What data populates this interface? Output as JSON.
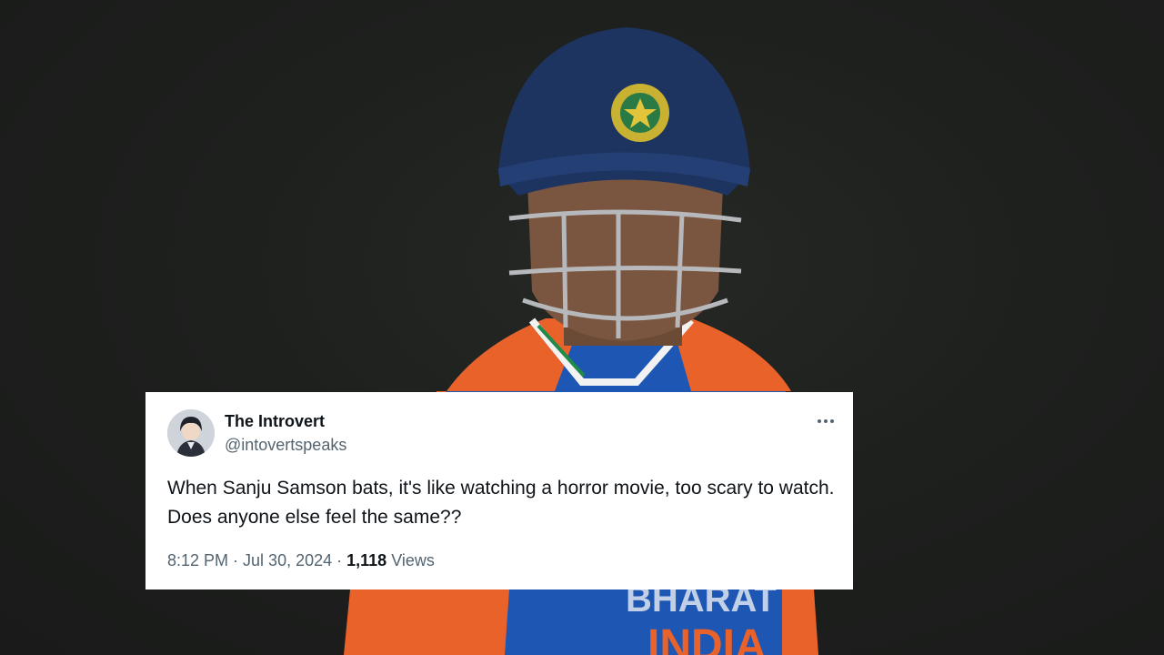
{
  "tweet": {
    "display_name": "The Introvert",
    "handle": "@intovertspeaks",
    "more_icon": "more-horizontal-icon",
    "text": "When Sanju Samson bats, it's like watching a horror movie, too scary to watch. Does anyone else feel the same??",
    "time": "8:12 PM",
    "separator": "·",
    "date": "Jul 30, 2024",
    "views_count": "1,118",
    "views_label": "Views"
  },
  "background": {
    "jersey_text_top": "BHARAT",
    "jersey_text_bottom": "INDIA"
  },
  "colors": {
    "helmet": "#1d3360",
    "jersey_orange": "#e8622a",
    "jersey_blue": "#1e56b4",
    "card_bg": "#ffffff",
    "name_text": "#0f1419",
    "secondary_text": "#536471"
  }
}
